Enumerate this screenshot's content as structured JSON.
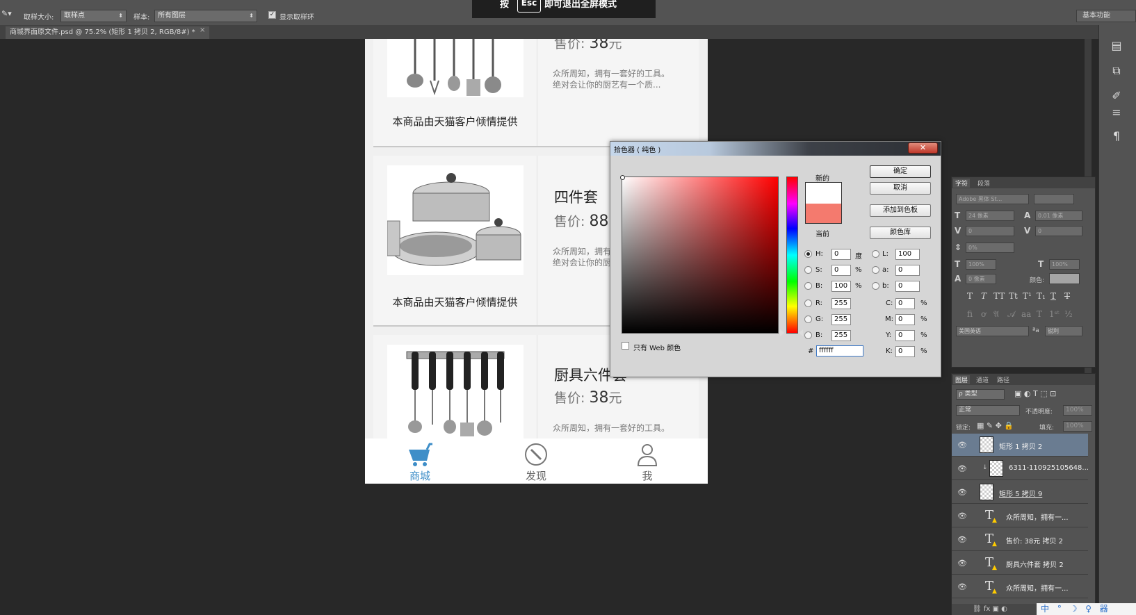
{
  "options_bar": {
    "sample_size_label": "取样大小:",
    "sample_size_value": "取样点",
    "sample_label": "样本:",
    "sample_value": "所有图层",
    "show_ring_label": "显示取样环",
    "workspace": "基本功能"
  },
  "esc_toast": {
    "before": "按",
    "key": "Esc",
    "after": "即可退出全屏模式"
  },
  "document_tab": {
    "title": "商城界面原文件.psd @ 75.2% (矩形 1 拷贝 2, RGB/8#) *",
    "close": "×"
  },
  "canvas": {
    "products": [
      {
        "price_label": "售价:",
        "price_value": "38",
        "price_unit": "元",
        "desc_line1": "众所周知，拥有一套好的工具。",
        "desc_line2": "绝对会让你的厨艺有一个质...",
        "provider": "本商品由天猫客户倾情提供"
      },
      {
        "name": "四件套",
        "price_label": "售价:",
        "price_value": "88",
        "desc_line1": "众所周知，拥有",
        "desc_line2": "绝对会让你的厨",
        "provider": "本商品由天猫客户倾情提供"
      },
      {
        "name": "厨具六件套",
        "price_label": "售价:",
        "price_value": "38",
        "price_unit": "元",
        "desc_line1": "众所周知，拥有一套好的工具。"
      }
    ],
    "bottom_nav": [
      {
        "label": "商城",
        "icon": "cart-icon",
        "active": true
      },
      {
        "label": "发现",
        "icon": "compass-icon",
        "active": false
      },
      {
        "label": "我",
        "icon": "user-icon",
        "active": false
      }
    ],
    "accent_color": "#3e8ec8"
  },
  "color_picker": {
    "title": "拾色器 ( 纯色 )",
    "close": "✕",
    "new_label": "新的",
    "current_label": "当前",
    "new_color": "#ffffff",
    "current_color": "#f47a6e",
    "buttons": {
      "ok": "确定",
      "cancel": "取消",
      "add_swatch": "添加到色板",
      "libraries": "颜色库"
    },
    "fields": {
      "H": "0",
      "S": "0",
      "B": "100",
      "R": "255",
      "G": "255",
      "B2": "255",
      "L": "100",
      "a": "0",
      "b": "0",
      "C": "0",
      "M": "0",
      "Y": "0",
      "K": "0",
      "hex": "ffffff"
    },
    "labels": {
      "H": "H:",
      "S": "S:",
      "B": "B:",
      "R": "R:",
      "G": "G:",
      "B2": "B:",
      "L": "L:",
      "a": "a:",
      "b": "b:",
      "C": "C:",
      "M": "M:",
      "Y": "Y:",
      "K": "K:",
      "hash": "#",
      "deg": "度",
      "pct": "%"
    },
    "web_only": "只有 Web 颜色"
  },
  "char_panel": {
    "tabs": [
      "字符",
      "段落"
    ],
    "font_family": "Adobe 黑体 St...",
    "size": "24 像素",
    "leading": "0.01 像素",
    "tracking": "0",
    "kerning": "0",
    "scale_pct": "0%",
    "v_scale": "100%",
    "h_scale": "100%",
    "baseline": "0 像素",
    "color_label": "颜色:",
    "language": "美国英语",
    "aa_label": "ªa",
    "aa_value": "锐利"
  },
  "layers_panel": {
    "tabs": [
      "图层",
      "通道",
      "路径"
    ],
    "filter": "ρ 类型",
    "blend": "正常",
    "opacity_label": "不透明度:",
    "opacity": "100%",
    "lock_label": "锁定:",
    "fill_label": "填充:",
    "fill": "100%",
    "layers": [
      {
        "name": "矩形 1 拷贝 2",
        "type": "shape",
        "selected": true
      },
      {
        "name": "6311-110925105648...",
        "type": "image",
        "selected": false
      },
      {
        "name": "矩形 5 拷贝 9",
        "type": "shape",
        "selected": false
      },
      {
        "name": "众所周知，拥有一...",
        "type": "text",
        "selected": false
      },
      {
        "name": "售价: 38元 拷贝 2",
        "type": "text",
        "selected": false
      },
      {
        "name": "厨具六件套 拷贝 2",
        "type": "text",
        "selected": false
      },
      {
        "name": "众所周知，拥有一...",
        "type": "text",
        "selected": false
      }
    ]
  },
  "ime_bar": "中 ° ☽ ♀ 器"
}
